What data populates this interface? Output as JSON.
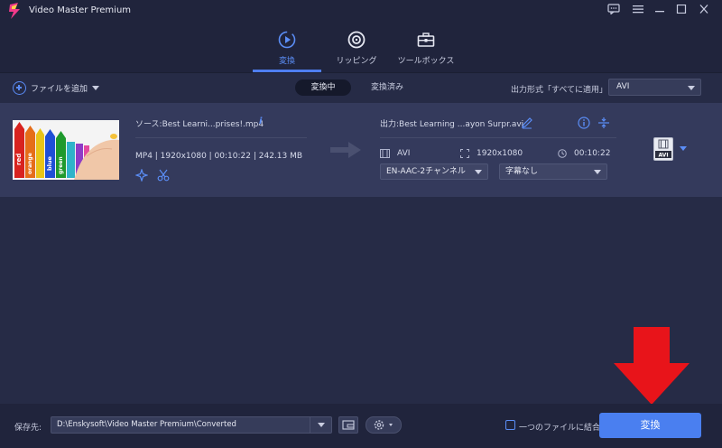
{
  "app": {
    "title": "Video Master Premium",
    "window_controls": [
      "feedback-icon",
      "menu-icon",
      "minimize-icon",
      "maximize-icon",
      "close-icon"
    ]
  },
  "nav": {
    "tabs": [
      {
        "label": "変換",
        "icon": "convert-icon",
        "active": true
      },
      {
        "label": "リッピング",
        "icon": "disc-icon",
        "active": false
      },
      {
        "label": "ツールボックス",
        "icon": "toolbox-icon",
        "active": false
      }
    ],
    "accent": "#4e7ef0"
  },
  "toolbar": {
    "add_file_label": "ファイルを追加",
    "seg_converting": "変換中",
    "seg_converted": "変換済み",
    "output_format_label": "出力形式「すべてに適用」:",
    "output_format_value": "AVI"
  },
  "file": {
    "source_name": "ソース:Best Learni...prises!.mp4",
    "source_meta": "MP4 | 1920x1080 | 00:10:22 | 242.13 MB",
    "output_name": "出力:Best Learning ...ayon Surpr.avi",
    "output_format": "AVI",
    "output_resolution": "1920x1080",
    "output_duration": "00:10:22",
    "audio_track": "EN-AAC-2チャンネル",
    "subtitle": "字幕なし",
    "format_badge": "AVI",
    "thumbnail_labels": [
      "red",
      "orange",
      "blue",
      "green"
    ]
  },
  "bottom": {
    "save_label": "保存先:",
    "save_path": "D:\\Enskysoft\\Video Master Premium\\Converted",
    "merge_label": "一つのファイルに結合",
    "convert_label": "変換"
  }
}
